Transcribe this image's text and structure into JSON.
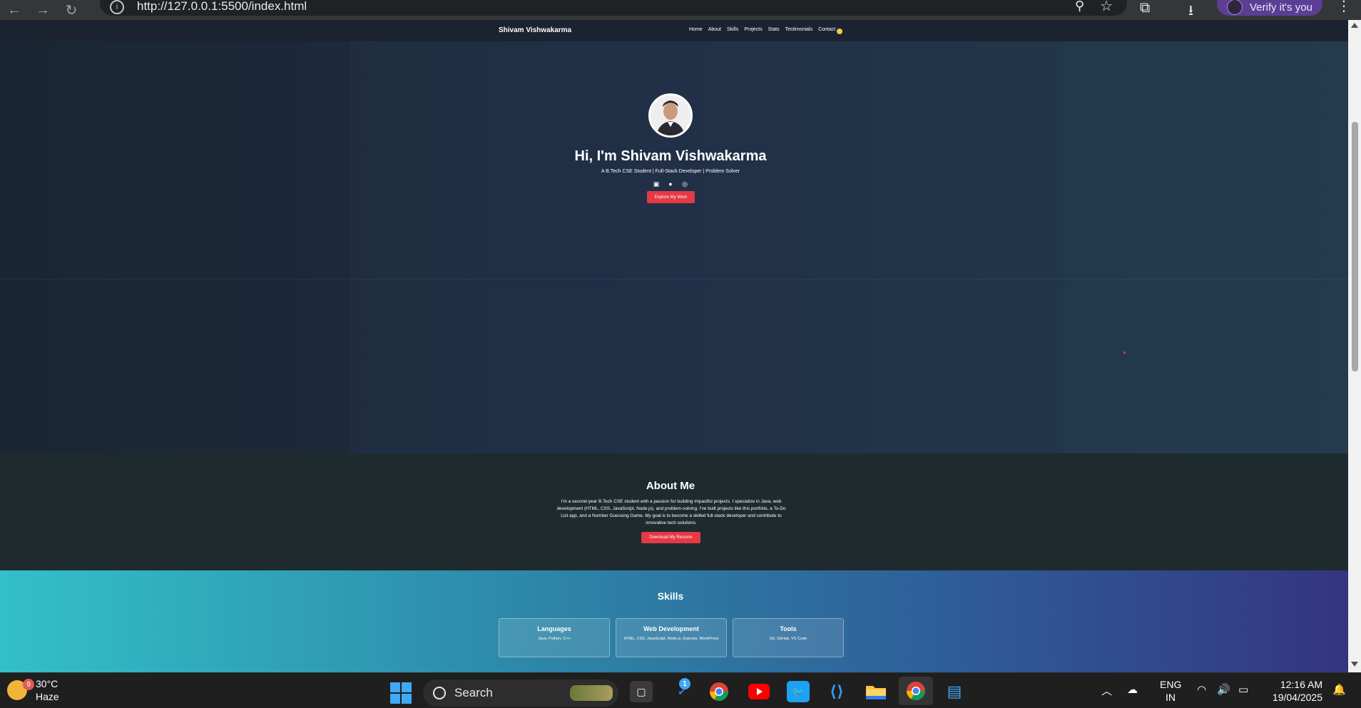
{
  "browser": {
    "url": "http://127.0.0.1:5500/index.html",
    "profile_label": "Verify it's you"
  },
  "site": {
    "brand": "Shivam Vishwakarma",
    "nav": [
      "Home",
      "About",
      "Skills",
      "Projects",
      "Stats",
      "Testimonials",
      "Contact"
    ]
  },
  "hero": {
    "title": "Hi, I'm Shivam Vishwakarma",
    "subtitle": "A B.Tech CSE Student | Full-Stack Developer | Problem Solver",
    "cta": "Explore My Work",
    "socials": [
      "linkedin-icon",
      "github-icon",
      "instagram-icon"
    ]
  },
  "about": {
    "heading": "About Me",
    "text": "I'm a second-year B.Tech CSE student with a passion for building impactful projects. I specialize in Java, web development (HTML, CSS, JavaScript, Node.js), and problem-solving. I've built projects like this portfolio, a To-Do List app, and a Number Guessing Game. My goal is to become a skilled full-stack developer and contribute to innovative tech solutions.",
    "button": "Download My Resume"
  },
  "skills": {
    "heading": "Skills",
    "cards": [
      {
        "title": "Languages",
        "desc": "Java, Python, C++"
      },
      {
        "title": "Web Development",
        "desc": "HTML, CSS, JavaScript, Node.js, Express, WordPress"
      },
      {
        "title": "Tools",
        "desc": "Git, GitHub, VS Code"
      }
    ]
  },
  "taskbar": {
    "weather_temp": "30°C",
    "weather_desc": "Haze",
    "weather_badge": "9",
    "search_label": "Search",
    "todo_badge": "1",
    "lang_top": "ENG",
    "lang_bottom": "IN",
    "time": "12:16 AM",
    "date": "19/04/2025"
  }
}
